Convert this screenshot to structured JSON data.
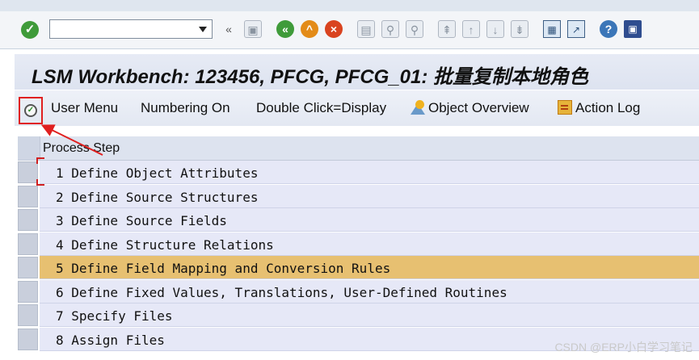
{
  "title": "LSM Workbench: 123456, PFCG, PFCG_01: 批量复制本地角色",
  "command_field": {
    "value": ""
  },
  "app_toolbar": {
    "user_menu": "User Menu",
    "numbering_on": "Numbering On",
    "double_click": "Double Click=Display",
    "object_overview": "Object Overview",
    "action_log": "Action Log"
  },
  "grid": {
    "header": "Process Step",
    "rows": [
      {
        "num": "1",
        "label": "Define Object Attributes"
      },
      {
        "num": "2",
        "label": "Define Source Structures"
      },
      {
        "num": "3",
        "label": "Define Source Fields"
      },
      {
        "num": "4",
        "label": "Define Structure Relations"
      },
      {
        "num": "5",
        "label": "Define Field Mapping and Conversion Rules",
        "highlighted": true
      },
      {
        "num": "6",
        "label": "Define Fixed Values, Translations, User-Defined Routines"
      },
      {
        "num": "7",
        "label": "Specify Files"
      },
      {
        "num": "8",
        "label": "Assign Files"
      }
    ]
  },
  "colors": {
    "highlight_row": "#e7c071",
    "row_bg": "#e6e8f7",
    "annotation_red": "#e02020"
  },
  "watermark": "CSDN @ERP小白学习笔记"
}
